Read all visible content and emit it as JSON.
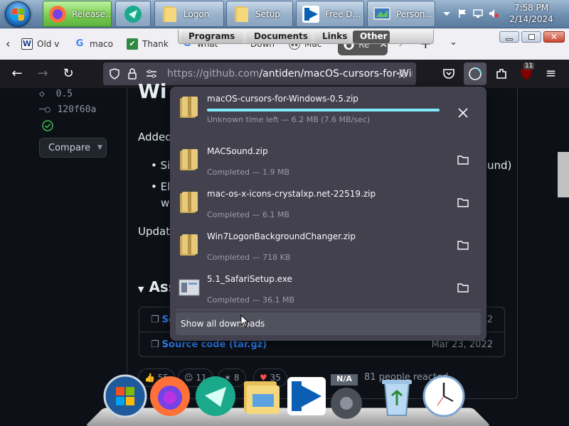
{
  "taskbar": {
    "buttons": [
      {
        "label": "Release...",
        "icon": "firefox-icon",
        "active": true
      },
      {
        "label": "",
        "icon": "teal-app-icon"
      },
      {
        "label": "Logon",
        "icon": "folder-icon"
      },
      {
        "label": "Setup",
        "icon": "folder-icon"
      },
      {
        "label": "Free D...",
        "icon": "free-download-icon"
      },
      {
        "label": "Person...",
        "icon": "personalize-icon"
      }
    ],
    "clock": {
      "time": "7:58 PM",
      "date": "2/14/2024"
    }
  },
  "quick_bar": {
    "items": [
      "Programs",
      "Documents",
      "Links",
      "Other"
    ]
  },
  "tabs": [
    {
      "label": "Old v",
      "icon": "w-icon"
    },
    {
      "label": "maco",
      "icon": "google-icon"
    },
    {
      "label": "Thank",
      "icon": "green-icon"
    },
    {
      "label": "what",
      "icon": "google-icon"
    },
    {
      "label": "Down",
      "icon": "blank-icon"
    },
    {
      "label": "Mac",
      "icon": "wordpress-icon"
    },
    {
      "label": "Re",
      "icon": "github-icon"
    }
  ],
  "url": {
    "host": "https://github.com",
    "path": "/antiden/macOS-cursors-for-Win"
  },
  "notif_badge": "11",
  "sidebar": {
    "tag": "0.5",
    "commit": "120f60a",
    "compare_label": "Compare"
  },
  "release": {
    "line1": "Added",
    "bullet1": "Si",
    "bullet2a": "El",
    "bullet2b": "w",
    "bullet1_tail": "und)",
    "update": "Updat",
    "assets_heading": "Ass",
    "assets": [
      {
        "label": "Source code (zip)",
        "shown": "Sou",
        "date": "22"
      },
      {
        "label": "Source code (tar.gz)",
        "date": "Mar 23, 2022"
      }
    ],
    "reactions": [
      "55",
      "11",
      "8",
      "35"
    ],
    "reacted_text": "81 people reacted"
  },
  "downloads": {
    "items": [
      {
        "name": "macOS-cursors-for-Windows-0.5.zip",
        "status": "Unknown time left — 6.2 MB (7.6 MB/sec)",
        "in_progress": true,
        "progress": 1.0
      },
      {
        "name": "MACSound.zip",
        "status": "Completed — 1.9 MB"
      },
      {
        "name": "mac-os-x-icons-crystalxp.net-22519.zip",
        "status": "Completed — 6.1 MB"
      },
      {
        "name": "Win7LogonBackgroundChanger.zip",
        "status": "Completed — 718 KB"
      },
      {
        "name": "5.1_SafariSetup.exe",
        "status": "Completed — 36.1 MB",
        "type": "exe"
      }
    ],
    "show_all_label": "Show all downloads"
  },
  "dock": {
    "apps": [
      "windows-start-icon",
      "firefox-icon",
      "teal-app-icon",
      "folder-icon",
      "free-download-icon",
      "settings-icon",
      "recycle-bin-icon",
      "clock-icon"
    ],
    "na_badge": "N/A"
  },
  "colors": {
    "accent": "#80ebff",
    "link": "#2f81f7",
    "panel": "#42414d"
  }
}
